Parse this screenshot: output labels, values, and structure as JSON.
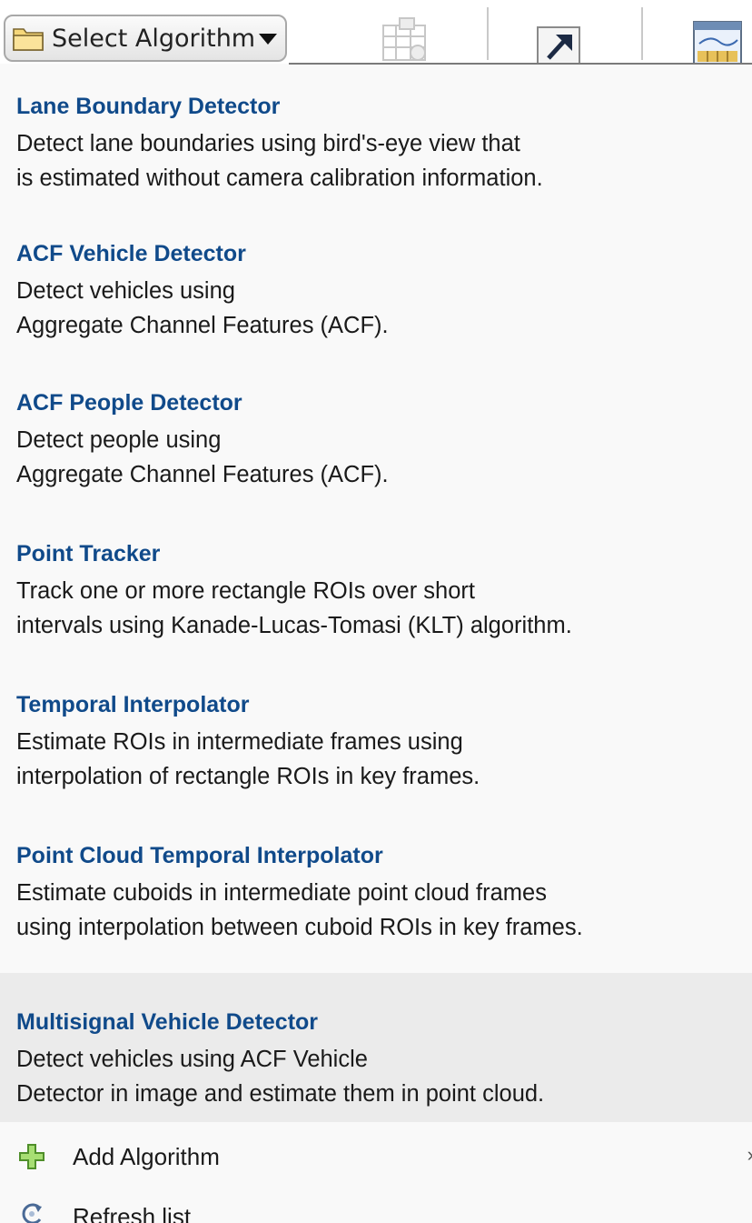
{
  "toolbar": {
    "select_label": "Select Algorithm",
    "icons": [
      "folder-icon",
      "caret-down-icon",
      "automate-icon",
      "export-arrow-icon",
      "view-layout-icon"
    ]
  },
  "algorithms": [
    {
      "title": "Lane Boundary Detector",
      "desc1": "Detect lane boundaries using bird's-eye view that",
      "desc2": "is estimated without camera calibration information."
    },
    {
      "title": "ACF Vehicle Detector",
      "desc1": "Detect vehicles using",
      "desc2": "Aggregate Channel Features (ACF)."
    },
    {
      "title": "ACF People Detector",
      "desc1": "Detect people using",
      "desc2": "Aggregate Channel Features (ACF)."
    },
    {
      "title": "Point Tracker",
      "desc1": "Track one or more rectangle ROIs over short",
      "desc2": "intervals using Kanade-Lucas-Tomasi (KLT) algorithm."
    },
    {
      "title": "Temporal Interpolator",
      "desc1": "Estimate ROIs in intermediate frames using",
      "desc2": "interpolation of rectangle ROIs in key frames."
    },
    {
      "title": "Point Cloud Temporal Interpolator",
      "desc1": "Estimate cuboids in intermediate point cloud frames",
      "desc2": "using interpolation between cuboid ROIs in key frames."
    },
    {
      "title": "Multisignal Vehicle Detector",
      "desc1": "Detect vehicles using ACF Vehicle",
      "desc2": "Detector in image and estimate them in point cloud."
    }
  ],
  "actions": {
    "add_label": "Add Algorithm",
    "refresh_label": "Refresh list"
  },
  "colors": {
    "title": "#104a8a",
    "hover_bg": "#ebebeb",
    "add_icon": "#7cc24a"
  }
}
